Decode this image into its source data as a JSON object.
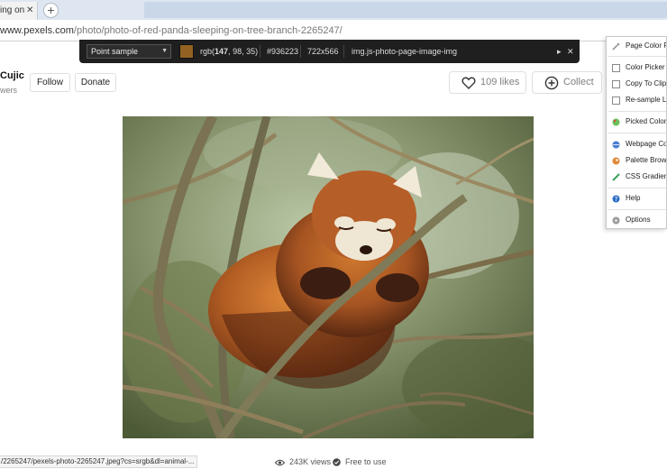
{
  "browser": {
    "tab_title": "ing on",
    "tab_close": "✕",
    "new_tab": "+",
    "url_host": "www.pexels.com",
    "url_path": "/photo/photo-of-red-panda-sleeping-on-tree-branch-2265247/"
  },
  "color_picker": {
    "mode": "Point sample",
    "rgb_prefix": "rgb(",
    "r": "147",
    "g": "98",
    "b": "35",
    "rgb_suffix": ")",
    "hex": "#936223",
    "swatch_color": "#936223",
    "dimensions": "722x566",
    "selector": "img.js-photo-page-image-img",
    "next_icon": "arrow-right-icon",
    "close_icon": "close-icon"
  },
  "context_menu": {
    "items": [
      {
        "label": "Page Color P",
        "icon": "eyedropper-icon"
      },
      {
        "label": "Color Picker",
        "icon": "checkbox-icon"
      },
      {
        "label": "Copy To Clipb",
        "icon": "checkbox-icon"
      },
      {
        "label": "Re-sample La",
        "icon": "checkbox-icon"
      },
      {
        "label": "Picked Color I",
        "icon": "palette-icon"
      },
      {
        "label": "Webpage Colo",
        "icon": "webpage-icon"
      },
      {
        "label": "Palette Brows",
        "icon": "palette-browser-icon"
      },
      {
        "label": "CSS Gradient",
        "icon": "gradient-icon"
      },
      {
        "label": "Help",
        "icon": "help-icon"
      },
      {
        "label": "Options",
        "icon": "options-icon"
      }
    ]
  },
  "author": {
    "name": "Cujic",
    "followers": "wers",
    "follow_label": "Follow",
    "donate_label": "Donate"
  },
  "actions": {
    "likes_label": "109 likes",
    "collect_label": "Collect"
  },
  "footer": {
    "status_url": "/2265247/pexels-photo-2265247.jpeg?cs=srgb&dl=animal-...",
    "views": "243K views",
    "license": "Free to use"
  }
}
